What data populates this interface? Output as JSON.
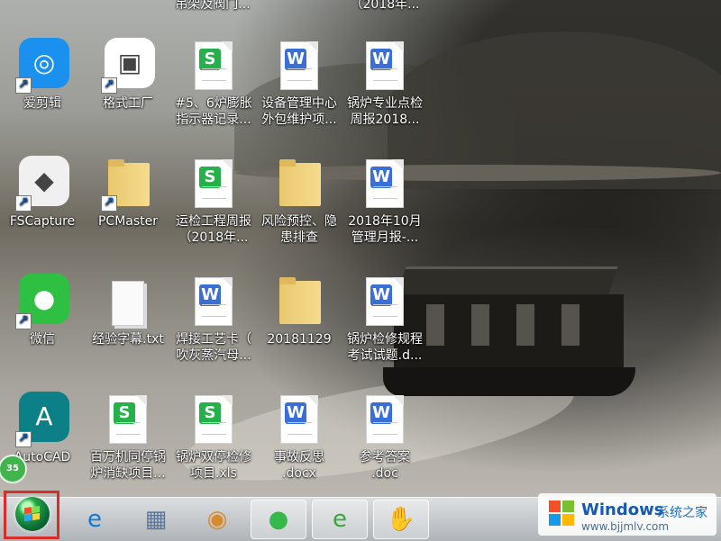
{
  "desktop": {
    "top_partial_labels": [
      "吊架及阀门...",
      "（2018年..."
    ],
    "icons": [
      {
        "label_lines": [
          "爱剪辑"
        ],
        "kind": "app",
        "icon": "video-editor-icon",
        "color": "#1a91ef",
        "shortcut": true
      },
      {
        "label_lines": [
          "格式工厂"
        ],
        "kind": "app",
        "icon": "format-factory-icon",
        "color": "#ffffff",
        "shortcut": true
      },
      {
        "label_lines": [
          "#5、6炉膨胀",
          "指示器记录..."
        ],
        "kind": "sheet",
        "icon": "spreadsheet-file-icon",
        "badge": "S"
      },
      {
        "label_lines": [
          "设备管理中心",
          "外包维护项..."
        ],
        "kind": "word",
        "icon": "word-file-icon",
        "badge": "W"
      },
      {
        "label_lines": [
          "锅炉专业点检",
          "周报2018..."
        ],
        "kind": "word",
        "icon": "word-file-icon",
        "badge": "W"
      },
      {
        "label_lines": [
          "FSCapture"
        ],
        "kind": "app",
        "icon": "fscapture-icon",
        "color": "#f0f0f0",
        "shortcut": true
      },
      {
        "label_lines": [
          "PCMaster"
        ],
        "kind": "folder",
        "icon": "pcmaster-folder-icon",
        "shortcut": true
      },
      {
        "label_lines": [
          "运检工程周报",
          "（2018年..."
        ],
        "kind": "sheet",
        "icon": "spreadsheet-file-icon",
        "badge": "S"
      },
      {
        "label_lines": [
          "风险预控、隐",
          "患排查"
        ],
        "kind": "folder",
        "icon": "folder-icon"
      },
      {
        "label_lines": [
          "2018年10月",
          "管理月报-..."
        ],
        "kind": "word",
        "icon": "word-file-icon",
        "badge": "W"
      },
      {
        "label_lines": [
          "微信"
        ],
        "kind": "app",
        "icon": "wechat-icon",
        "color": "#2fc043",
        "shortcut": true
      },
      {
        "label_lines": [
          "经验字幕.txt"
        ],
        "kind": "paper",
        "icon": "text-file-icon"
      },
      {
        "label_lines": [
          "焊接工艺卡（",
          "吹灰蒸汽母..."
        ],
        "kind": "word",
        "icon": "word-file-icon",
        "badge": "W"
      },
      {
        "label_lines": [
          "20181129"
        ],
        "kind": "folder",
        "icon": "folder-icon"
      },
      {
        "label_lines": [
          "锅炉检修规程",
          "考试试题.d..."
        ],
        "kind": "word",
        "icon": "word-file-icon",
        "badge": "W"
      },
      {
        "label_lines": [
          "AutoCAD"
        ],
        "kind": "app",
        "icon": "autocad-icon",
        "color": "#0c7f87",
        "shortcut": true
      },
      {
        "label_lines": [
          "百万机同停锅",
          "炉消缺项目..."
        ],
        "kind": "sheet",
        "icon": "spreadsheet-file-icon",
        "badge": "S"
      },
      {
        "label_lines": [
          "锅炉双停检修",
          "项目.xls"
        ],
        "kind": "sheet",
        "icon": "spreadsheet-file-icon",
        "badge": "S"
      },
      {
        "label_lines": [
          "事故反思",
          ".docx"
        ],
        "kind": "word",
        "icon": "word-file-icon",
        "badge": "W"
      },
      {
        "label_lines": [
          "参考答案",
          ".doc"
        ],
        "kind": "word",
        "icon": "word-file-icon",
        "badge": "W"
      }
    ]
  },
  "notification_badge": "35",
  "taskbar": {
    "start_button": "start-orb",
    "items": [
      {
        "name": "internet-explorer-icon",
        "glyph": "e",
        "active": false,
        "color": "#1479d4"
      },
      {
        "name": "calculator-icon",
        "glyph": "▦",
        "active": false,
        "color": "#5b7795"
      },
      {
        "name": "paint-palette-icon",
        "glyph": "◉",
        "active": false,
        "color": "#d88a2a"
      },
      {
        "name": "wechat-taskbar-icon",
        "glyph": "●",
        "active": true,
        "color": "#35b94a"
      },
      {
        "name": "browser-green-icon",
        "glyph": "e",
        "active": true,
        "color": "#37a93a"
      },
      {
        "name": "hand-app-icon",
        "glyph": "✋",
        "active": true,
        "color": "#ef5f31"
      }
    ]
  },
  "watermark": {
    "brand": "Windows",
    "chinese": "系统之家",
    "url": "www.bjjmlv.com"
  }
}
